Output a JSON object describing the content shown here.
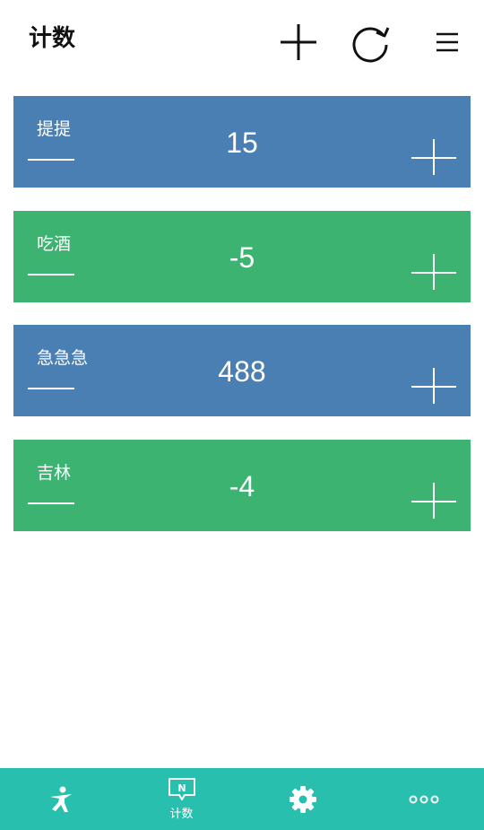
{
  "header": {
    "title": "计数",
    "add_icon": "plus-icon",
    "refresh_icon": "refresh-icon",
    "menu_icon": "menu-icon"
  },
  "counters": [
    {
      "name": "提提",
      "value": "15",
      "color": "#4a7fb3"
    },
    {
      "name": "吃酒",
      "value": "-5",
      "color": "#3cb371"
    },
    {
      "name": "急急急",
      "value": "488",
      "color": "#4a7fb3"
    },
    {
      "name": "吉林",
      "value": "-4",
      "color": "#3cb371"
    }
  ],
  "bottom_nav": {
    "background": "#28bfae",
    "items": [
      {
        "icon": "person-icon",
        "label": ""
      },
      {
        "icon": "counter-icon",
        "label": "计数",
        "badge": "N"
      },
      {
        "icon": "gear-icon",
        "label": ""
      },
      {
        "icon": "more-icon",
        "label": ""
      }
    ]
  }
}
